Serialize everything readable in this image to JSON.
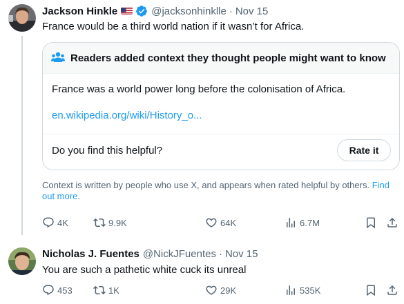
{
  "tweet1": {
    "name": "Jackson Hinkle",
    "handle": "@jacksonhinklle",
    "time": "Nov 15",
    "text": "France would be a third world nation if it wasn’t for Africa.",
    "note": {
      "title": "Readers added context they thought people might want to know",
      "body": "France was a world power long before the colonisation of Africa.",
      "link": "en.wikipedia.org/wiki/History_o...",
      "question": "Do you find this helpful?",
      "rate_button": "Rate it"
    },
    "disclaimer": "Context is written by people who use X, and appears when rated helpful by others.",
    "find_out_more": "Find out more",
    "disclaimer_end": ".",
    "stats": {
      "replies": "4K",
      "reposts": "9.9K",
      "likes": "64K",
      "views": "6.7M"
    }
  },
  "tweet2": {
    "name": "Nicholas J. Fuentes",
    "handle": "@NickJFuentes",
    "time": "Nov 15",
    "text": "You are such a pathetic white cuck its unreal",
    "stats": {
      "replies": "453",
      "reposts": "1K",
      "likes": "29K",
      "views": "535K"
    }
  },
  "separator": "·",
  "icons": [
    "flag-us-icon",
    "verified-badge-icon",
    "readers-icon",
    "reply-icon",
    "repost-icon",
    "like-icon",
    "views-icon",
    "bookmark-icon",
    "share-icon"
  ],
  "colors": {
    "link": "#1d9bf0",
    "verified": "#1d9bf0",
    "secondary_text": "#536471",
    "border": "#cfd9de"
  }
}
